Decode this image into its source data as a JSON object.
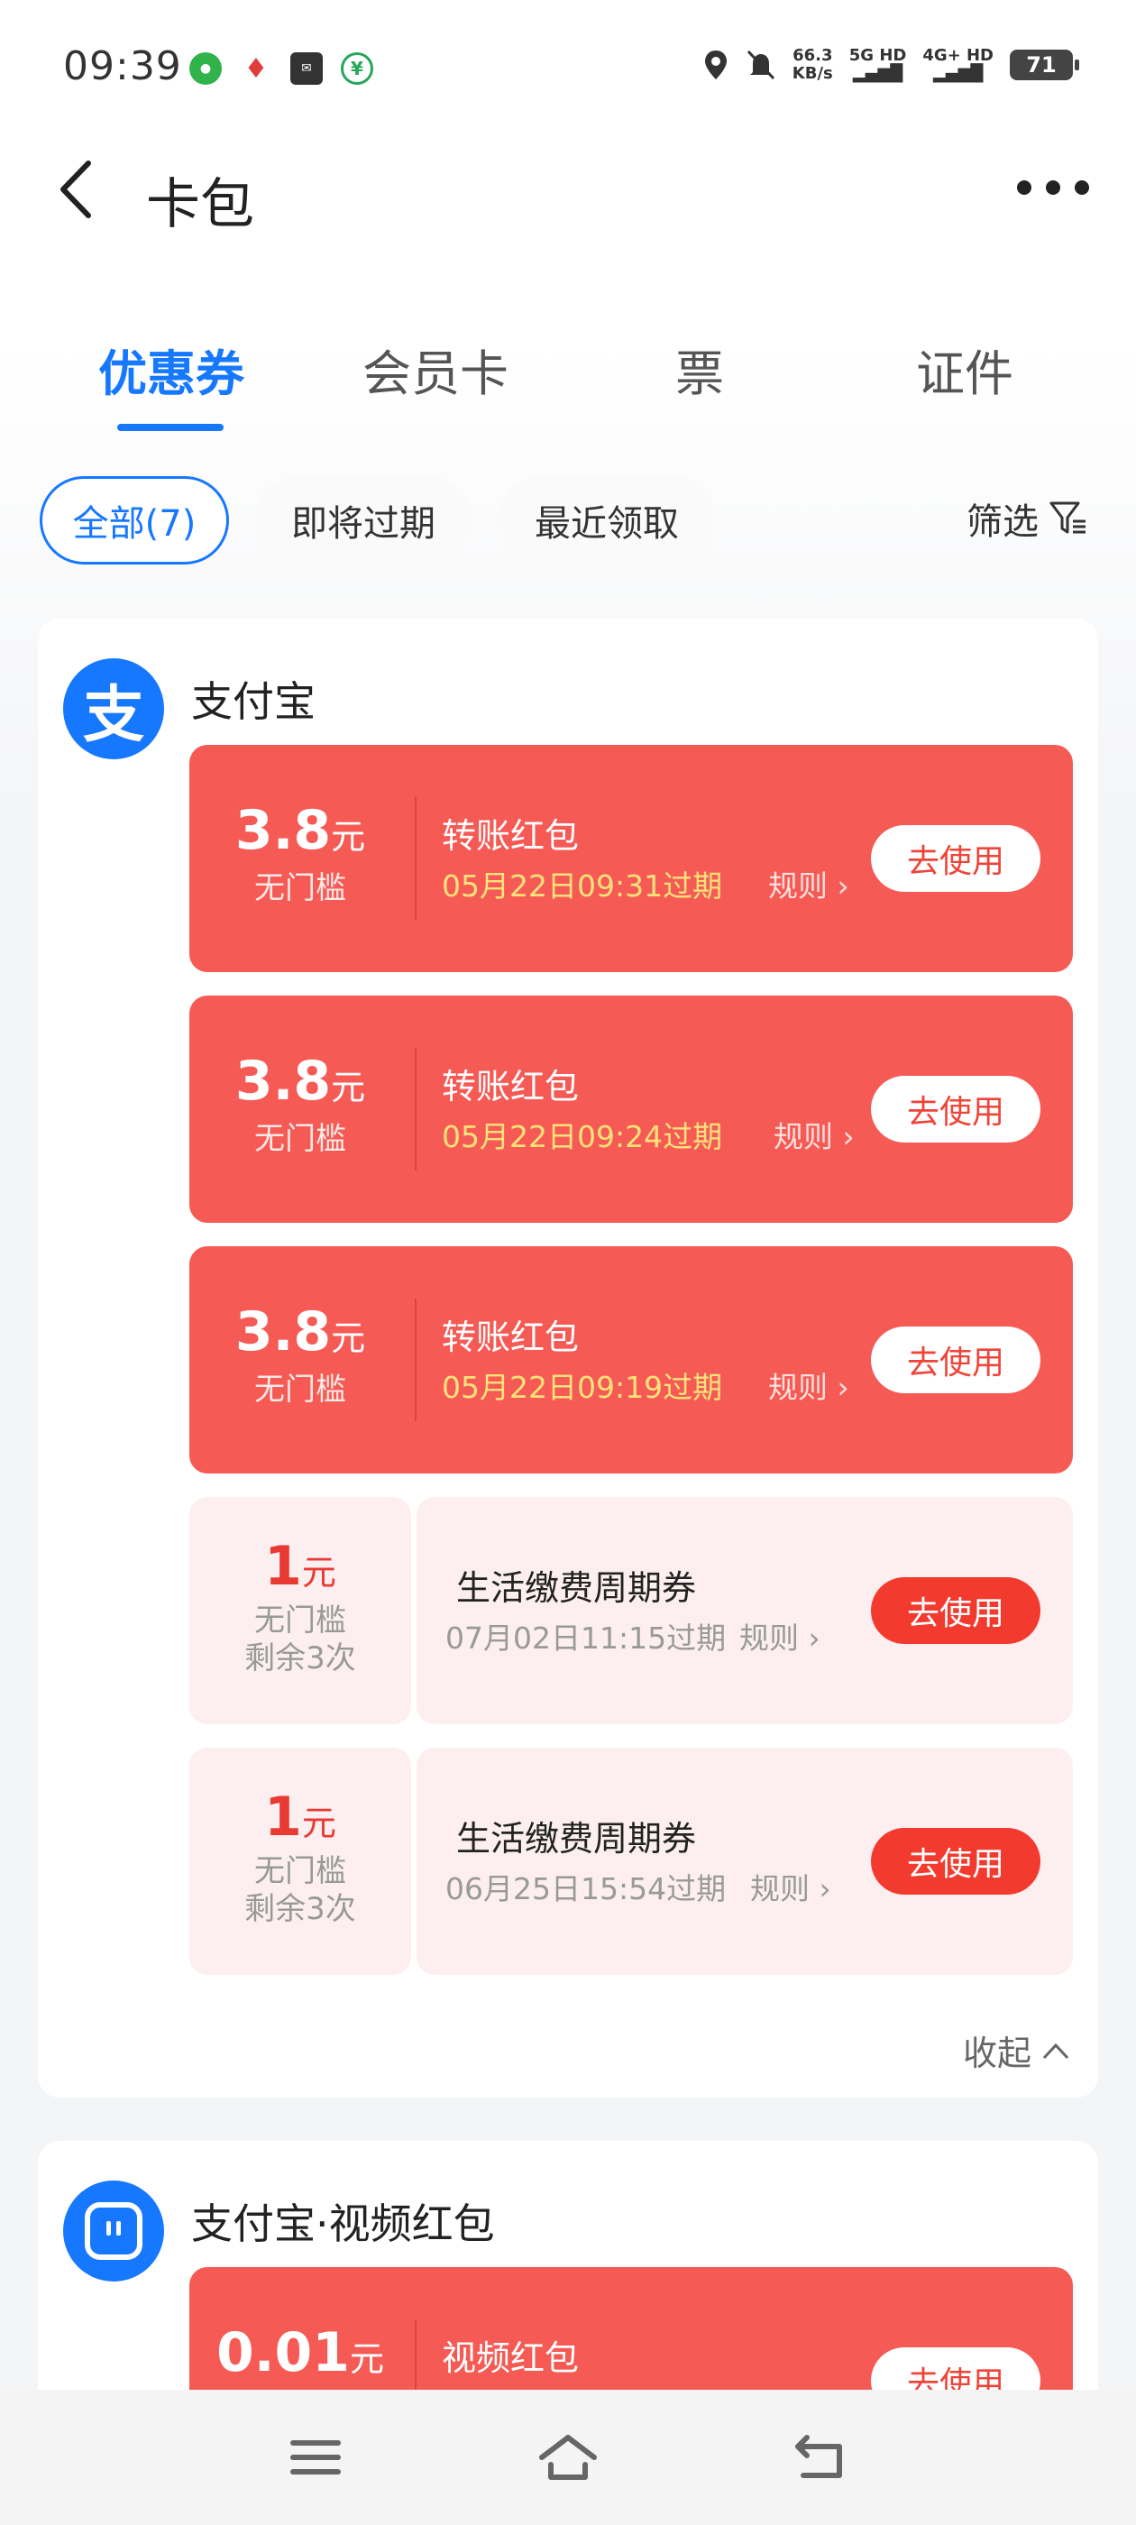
{
  "status_bar": {
    "time": "09:39",
    "net_speed_value": "66.3",
    "net_speed_unit": "KB/s",
    "sim1": "5G HD",
    "sim2": "4G+ HD",
    "battery": "71"
  },
  "nav": {
    "title": "卡包"
  },
  "tabs": [
    {
      "label": "优惠券",
      "active": true
    },
    {
      "label": "会员卡",
      "active": false
    },
    {
      "label": "票",
      "active": false
    },
    {
      "label": "证件",
      "active": false
    }
  ],
  "chips": [
    {
      "label": "全部(7)",
      "active": true
    },
    {
      "label": "即将过期",
      "active": false
    },
    {
      "label": "最近领取",
      "active": false
    }
  ],
  "filter_label": "筛选",
  "groups": [
    {
      "name": "支付宝",
      "logo": "支",
      "coupons": [
        {
          "amount": "3.8",
          "unit": "元",
          "condition": "无门槛",
          "title": "转账红包",
          "expire": "05月22日09:31过期",
          "rule": "规则",
          "button": "去使用"
        },
        {
          "amount": "3.8",
          "unit": "元",
          "condition": "无门槛",
          "title": "转账红包",
          "expire": "05月22日09:24过期",
          "rule": "规则",
          "button": "去使用"
        },
        {
          "amount": "3.8",
          "unit": "元",
          "condition": "无门槛",
          "title": "转账红包",
          "expire": "05月22日09:19过期",
          "rule": "规则",
          "button": "去使用"
        },
        {
          "amount": "1",
          "unit": "元",
          "condition": "无门槛",
          "remaining": "剩余3次",
          "title": "生活缴费周期券",
          "expire": "07月02日11:15过期",
          "rule": "规则",
          "button": "去使用"
        },
        {
          "amount": "1",
          "unit": "元",
          "condition": "无门槛",
          "remaining": "剩余3次",
          "title": "生活缴费周期券",
          "expire": "06月25日15:54过期",
          "rule": "规则",
          "button": "去使用"
        }
      ],
      "collapse_label": "收起"
    },
    {
      "name": "支付宝·视频红包",
      "coupons": [
        {
          "amount": "0.01",
          "unit": "元",
          "title": "视频红包",
          "button": "去使用"
        }
      ]
    }
  ],
  "colors": {
    "accent_blue": "#1677ff",
    "coupon_red": "#f55a55",
    "coupon_pink": "#fdeff0",
    "expire_yellow": "#ffe27a"
  }
}
